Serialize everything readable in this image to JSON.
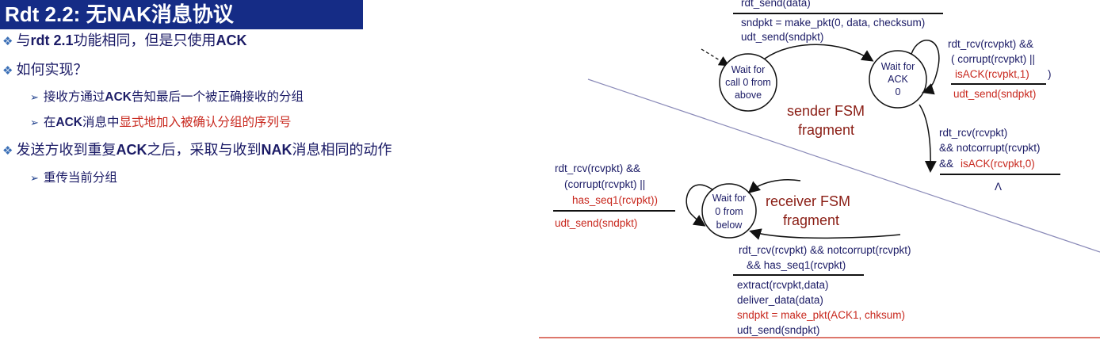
{
  "title": "Rdt 2.2: 无NAK消息协议",
  "bullets": [
    {
      "prefix": "与",
      "bold": "rdt 2.1",
      "rest": "功能相同，但是只使用",
      "bold2": "ACK"
    },
    {
      "text": "如何实现？"
    },
    {
      "prefix": "接收方通过",
      "bold": "ACK",
      "rest": "告知最后一个被正确接收的分组"
    },
    {
      "prefix": "在",
      "bold": "ACK",
      "rest": "消息中",
      "red": "显式地加入被确认分组的序列号"
    },
    {
      "prefix": "发送方收到重复",
      "bold": "ACK",
      "rest": "之后，采取与收到",
      "bold2": "NAK",
      "rest2": "消息相同的动作"
    },
    {
      "text": "重传当前分组"
    }
  ],
  "sender": {
    "label_line1": "sender FSM",
    "label_line2": "fragment",
    "state_wait_call": [
      "Wait for",
      "call 0 from",
      "above"
    ],
    "state_wait_ack": [
      "Wait for",
      "ACK",
      "0"
    ],
    "top_event": "rdt_send(data)",
    "top_actions": [
      "sndpkt = make_pkt(0, data, checksum)",
      "udt_send(sndpkt)"
    ],
    "self_loop_event": [
      "rdt_rcv(rcvpkt) &&",
      "( corrupt(rcvpkt) ||"
    ],
    "self_loop_event_red": "isACK(rcvpkt,1)",
    "self_loop_event_close": ")",
    "self_loop_action": "udt_send(sndpkt)",
    "down_event": [
      "rdt_rcv(rcvpkt)",
      "&& notcorrupt(rcvpkt)",
      "&& "
    ],
    "down_event_red": "isACK(rcvpkt,0)",
    "down_action": "Λ"
  },
  "receiver": {
    "label_line1": "receiver FSM",
    "label_line2": "fragment",
    "state_wait_below": [
      "Wait for",
      "0 from",
      "below"
    ],
    "self_loop_event": [
      "rdt_rcv(rcvpkt) &&",
      "(corrupt(rcvpkt) ||"
    ],
    "self_loop_event_red": "has_seq1(rcvpkt))",
    "self_loop_action": "udt_send(sndpkt)",
    "bottom_event": [
      "rdt_rcv(rcvpkt) && notcorrupt(rcvpkt)",
      "&& has_seq1(rcvpkt)"
    ],
    "bottom_actions": [
      "extract(rcvpkt,data)",
      "deliver_data(data)"
    ],
    "bottom_action_red": "sndpkt = make_pkt(ACK1, chksum)",
    "bottom_action_last": "udt_send(sndpkt)"
  },
  "colors": {
    "title_bg": "#152c86",
    "text": "#1b1b66",
    "highlight": "#c8281e",
    "fsm_label": "#8a1d14",
    "divider": "#8a8ab8"
  }
}
